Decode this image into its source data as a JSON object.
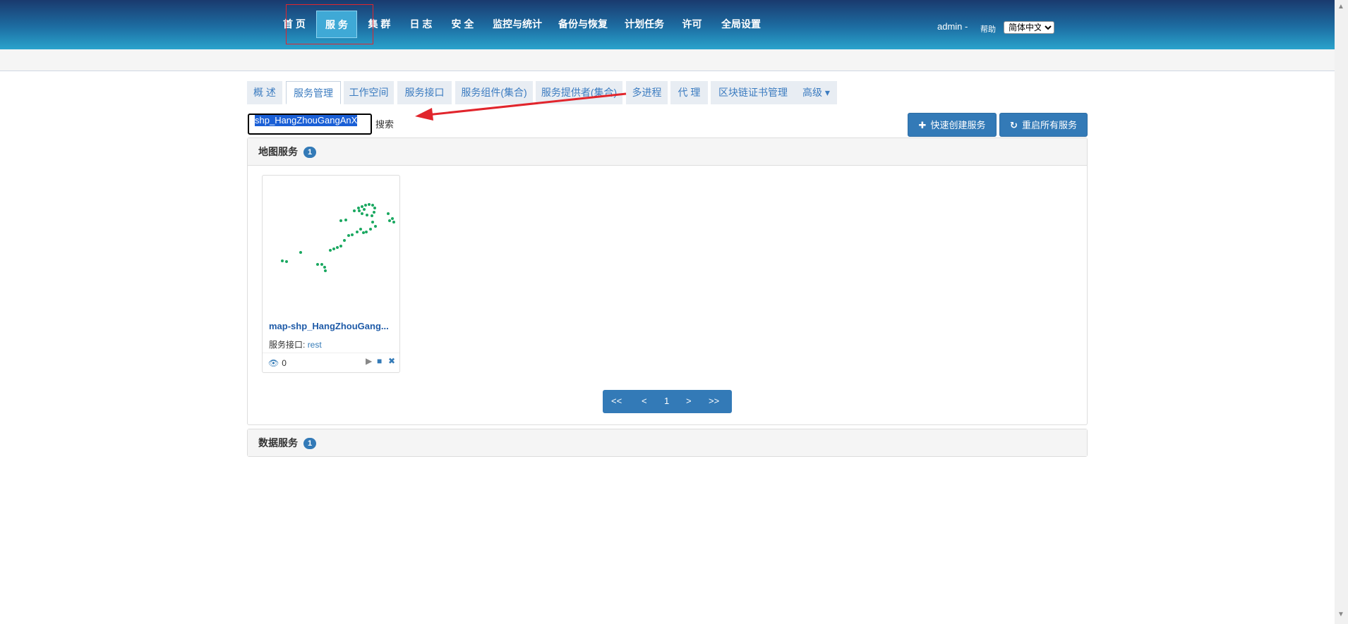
{
  "nav": {
    "items": [
      "首 页",
      "服 务",
      "集 群",
      "日 志",
      "安 全",
      "监控与统计",
      "备份与恢复",
      "计划任务",
      "许可",
      "全局设置"
    ],
    "active_index": 1
  },
  "user": {
    "name": "admin -",
    "help": "帮助",
    "language": "简体中文"
  },
  "tabs": {
    "items": [
      "概 述",
      "服务管理",
      "工作空间",
      "服务接口",
      "服务组件(集合)",
      "服务提供者(集合)",
      "多进程",
      "代 理",
      "区块链证书管理",
      "高级 ▾"
    ],
    "active_index": 1
  },
  "search": {
    "value": "shp_HangZhouGangAnX",
    "label": "搜索"
  },
  "actions": {
    "quick_create": "快速创建服务",
    "restart_all": "重启所有服务"
  },
  "map_services": {
    "title": "地图服务",
    "count": "1",
    "card": {
      "name": "map-shp_HangZhouGang...",
      "interface_label": "服务接口:",
      "interface_value": "rest",
      "views": "0"
    },
    "pager": {
      "first": "<<",
      "prev": "<",
      "page": "1",
      "next": ">",
      "last": ">>"
    }
  },
  "data_services": {
    "title": "数据服务",
    "count": "1"
  },
  "colors": {
    "accent": "#337ab7",
    "highlight": "#e1252c",
    "map_dots": "#1aa860"
  },
  "icons": {
    "quick_create": "plus-icon",
    "restart_all": "refresh-icon",
    "views": "eye-icon",
    "start": "play-icon",
    "stop": "stop-icon",
    "delete": "close-icon"
  }
}
